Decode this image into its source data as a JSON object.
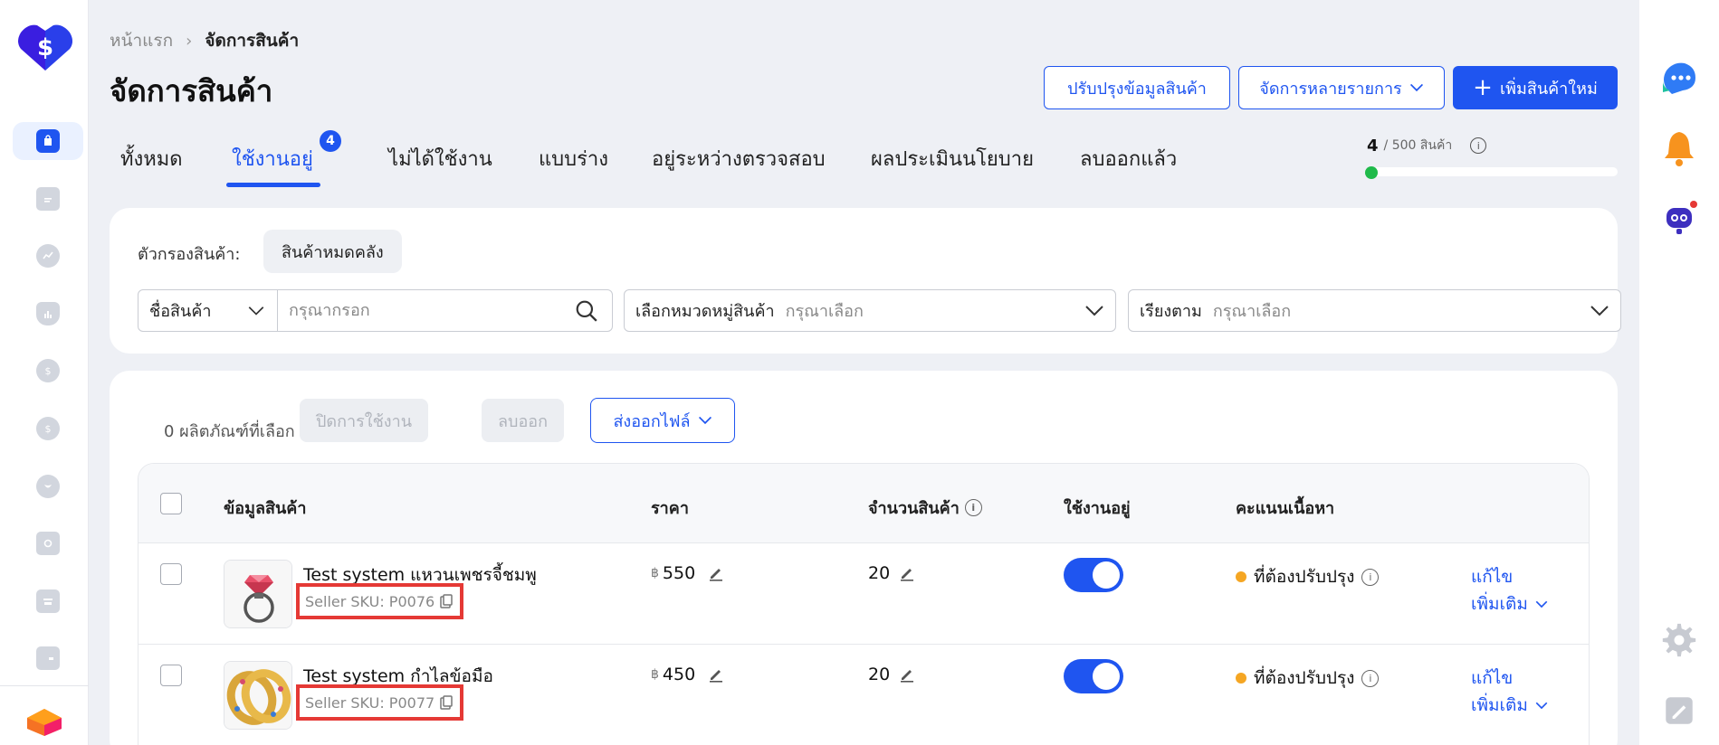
{
  "breadcrumb": {
    "home": "หน้าแรก",
    "current": "จัดการสินค้า"
  },
  "page_title": "จัดการสินค้า",
  "header_actions": {
    "update_info": "ปรับปรุงข้อมูลสินค้า",
    "bulk_manage": "จัดการหลายรายการ",
    "add_product": "เพิ่มสินค้าใหม่"
  },
  "tabs": [
    {
      "label": "ทั้งหมด"
    },
    {
      "label": "ใช้งานอยู่",
      "badge": "4",
      "active": true
    },
    {
      "label": "ไม่ได้ใช้งาน"
    },
    {
      "label": "แบบร่าง"
    },
    {
      "label": "อยู่ระหว่างตรวจสอบ"
    },
    {
      "label": "ผลประเมินนโยบาย"
    },
    {
      "label": "ลบออกแล้ว"
    }
  ],
  "quota": {
    "count": "4",
    "limit": "/ 500 สินค้า",
    "fill_fraction": 0.008
  },
  "filter": {
    "label": "ตัวกรองสินค้า:",
    "chip": "สินค้าหมดคลัง",
    "search_type": "ชื่อสินค้า",
    "search_placeholder": "กรุณากรอก",
    "category_label": "เลือกหมวดหมู่สินค้า",
    "category_placeholder": "กรุณาเลือก",
    "sort_label": "เรียงตาม",
    "sort_placeholder": "กรุณาเลือก"
  },
  "bulk": {
    "selected": "0 ผลิตภัณฑ์ที่เลือก",
    "deactivate": "ปิดการใช้งาน",
    "delete": "ลบออก",
    "export": "ส่งออกไฟล์"
  },
  "table": {
    "headers": {
      "product_info": "ข้อมูลสินค้า",
      "price": "ราคา",
      "quantity": "จำนวนสินค้า",
      "active": "ใช้งานอยู่",
      "content_score": "คะแนนเนื้อหา"
    },
    "rows": [
      {
        "name": "Test system แหวนเพชรจี้ชมพู",
        "sku": "Seller SKU: P0076",
        "currency": "฿",
        "price": "550",
        "quantity": "20",
        "active": true,
        "score": "ที่ต้องปรับปรุง",
        "edit": "แก้ไข",
        "more": "เพิ่มเติม",
        "thumb_icon": "ring-icon"
      },
      {
        "name": "Test system กำไลข้อมือ",
        "sku": "Seller SKU: P0077",
        "currency": "฿",
        "price": "450",
        "quantity": "20",
        "active": true,
        "score": "ที่ต้องปรับปรุง",
        "edit": "แก้ไข",
        "more": "เพิ่มเติม",
        "thumb_icon": "bracelet-icon"
      }
    ]
  },
  "colors": {
    "primary": "#1f55f0",
    "highlight": "#e53935",
    "warning": "#f5a623",
    "success": "#1fba4a"
  }
}
